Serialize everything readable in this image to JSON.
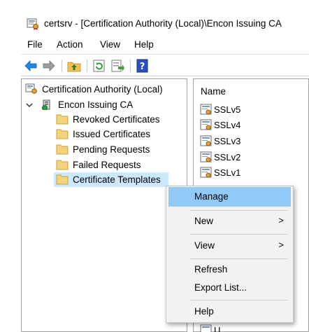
{
  "window": {
    "title": "certsrv - [Certification Authority (Local)\\Encon Issuing CA"
  },
  "menu": [
    "File",
    "Action",
    "View",
    "Help"
  ],
  "toolbar": {
    "buttons": [
      "back-icon",
      "forward-icon",
      "up-folder-icon",
      "refresh-icon",
      "export-list-icon",
      "help-icon"
    ]
  },
  "tree": {
    "root": "Certification Authority (Local)",
    "ca": "Encon Issuing CA",
    "folders": [
      "Revoked Certificates",
      "Issued Certificates",
      "Pending Requests",
      "Failed Requests",
      "Certificate Templates"
    ],
    "selected": "Certificate Templates"
  },
  "details": {
    "column": "Name",
    "items": [
      "SSLv5",
      "SSLv4",
      "SSLv3",
      "SSLv2",
      "SSLv1"
    ],
    "clipped_row_text": "U"
  },
  "context_menu": {
    "items": [
      {
        "label": "Manage",
        "submenu": false,
        "highlighted": true
      },
      {
        "label": "New",
        "submenu": true,
        "arrow": ">"
      },
      {
        "label": "View",
        "submenu": true,
        "arrow": ">"
      },
      {
        "label": "Refresh",
        "submenu": false
      },
      {
        "label": "Export List...",
        "submenu": false
      },
      {
        "label": "Help",
        "submenu": false
      }
    ]
  },
  "colors": {
    "selection": "#cce8ff",
    "menu_highlight": "#91c9f7",
    "folder": "#f5d37a"
  }
}
